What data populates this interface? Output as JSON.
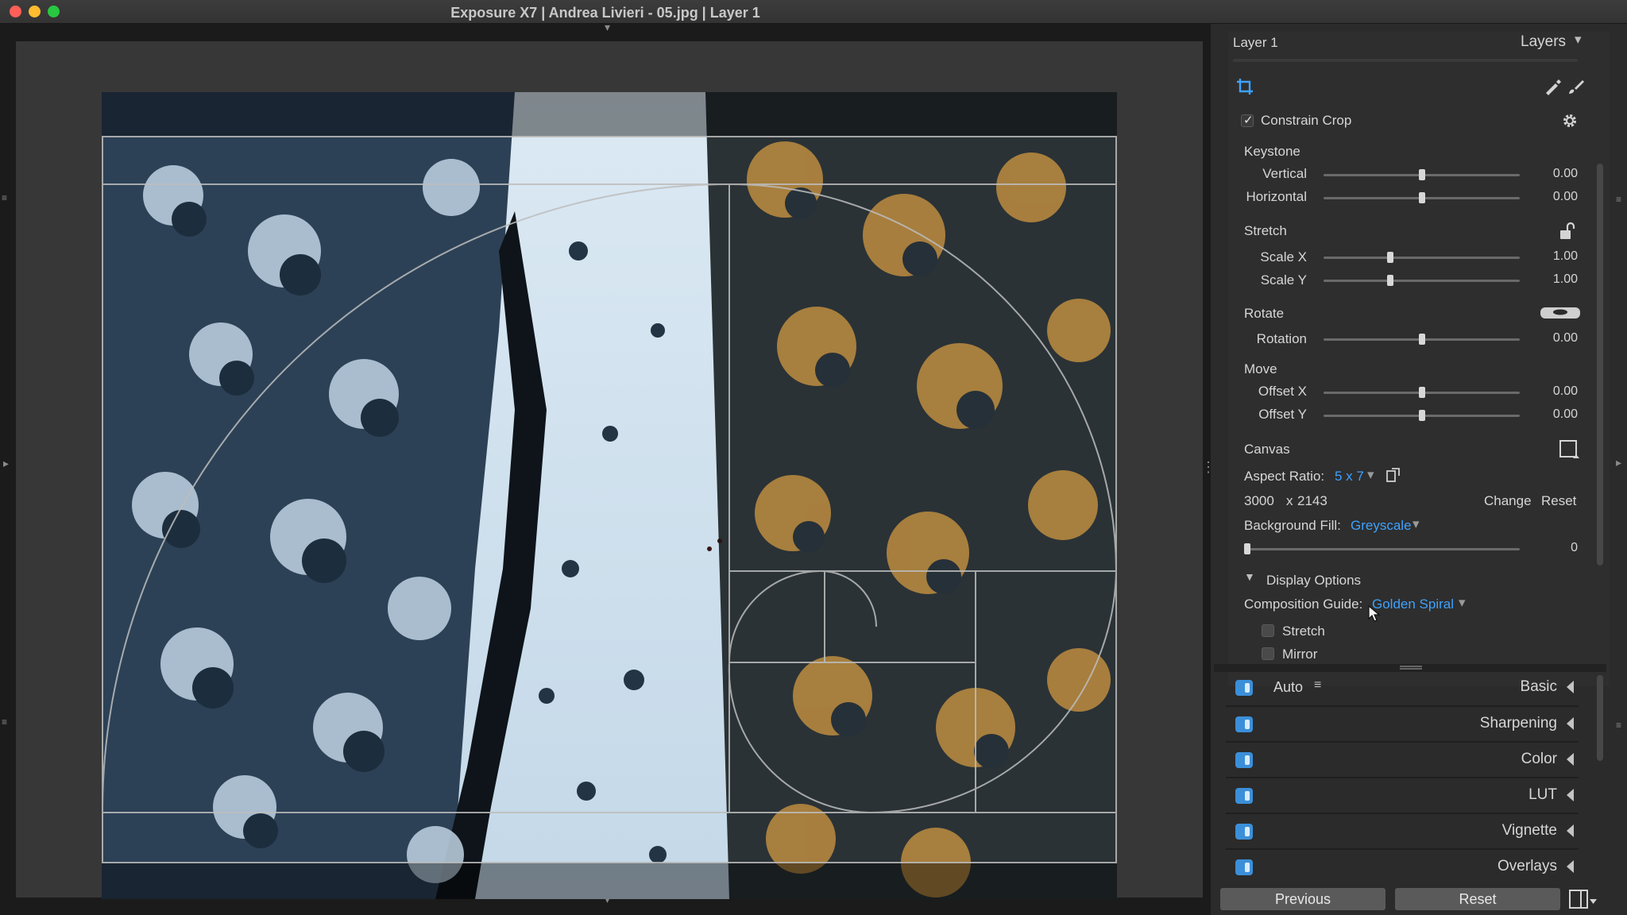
{
  "window": {
    "title": "Exposure X7 | Andrea Livieri - 05.jpg | Layer 1"
  },
  "panel": {
    "layer_name": "Layer 1",
    "layers_label": "Layers",
    "constrain_crop": {
      "label": "Constrain Crop",
      "checked": true
    },
    "keystone": {
      "title": "Keystone",
      "vertical": {
        "label": "Vertical",
        "value": "0.00",
        "level": 0.5
      },
      "horizontal": {
        "label": "Horizontal",
        "value": "0.00",
        "level": 0.5
      }
    },
    "stretch": {
      "title": "Stretch",
      "scale_x": {
        "label": "Scale X",
        "value": "1.00",
        "level": 0.34
      },
      "scale_y": {
        "label": "Scale Y",
        "value": "1.00",
        "level": 0.34
      }
    },
    "rotate": {
      "title": "Rotate",
      "rotation": {
        "label": "Rotation",
        "value": "0.00",
        "level": 0.5
      }
    },
    "move": {
      "title": "Move",
      "offset_x": {
        "label": "Offset X",
        "value": "0.00",
        "level": 0.5
      },
      "offset_y": {
        "label": "Offset Y",
        "value": "0.00",
        "level": 0.5
      }
    },
    "canvas": {
      "title": "Canvas",
      "aspect_ratio_label": "Aspect Ratio:",
      "aspect_ratio_value": "5 x 7",
      "width": "3000",
      "x": "x",
      "height": "2143",
      "change_label": "Change",
      "reset_label": "Reset",
      "background_fill_label": "Background Fill:",
      "background_fill_value": "Greyscale",
      "fill": {
        "value": "0",
        "level": 0.0
      }
    },
    "display_options": {
      "title": "Display Options",
      "composition_guide_label": "Composition Guide:",
      "composition_guide_value": "Golden Spiral",
      "stretch_label": "Stretch",
      "stretch_checked": false,
      "mirror_label": "Mirror",
      "mirror_checked": false
    },
    "sections": [
      {
        "label": "Basic",
        "auto_label": "Auto"
      },
      {
        "label": "Sharpening"
      },
      {
        "label": "Color"
      },
      {
        "label": "LUT"
      },
      {
        "label": "Vignette"
      },
      {
        "label": "Overlays"
      }
    ],
    "footer": {
      "previous_label": "Previous",
      "reset_label": "Reset"
    }
  },
  "colors": {
    "accent": "#3ea2ff",
    "panel_bg": "#2b2b2b",
    "viewer_bg": "#373737"
  }
}
